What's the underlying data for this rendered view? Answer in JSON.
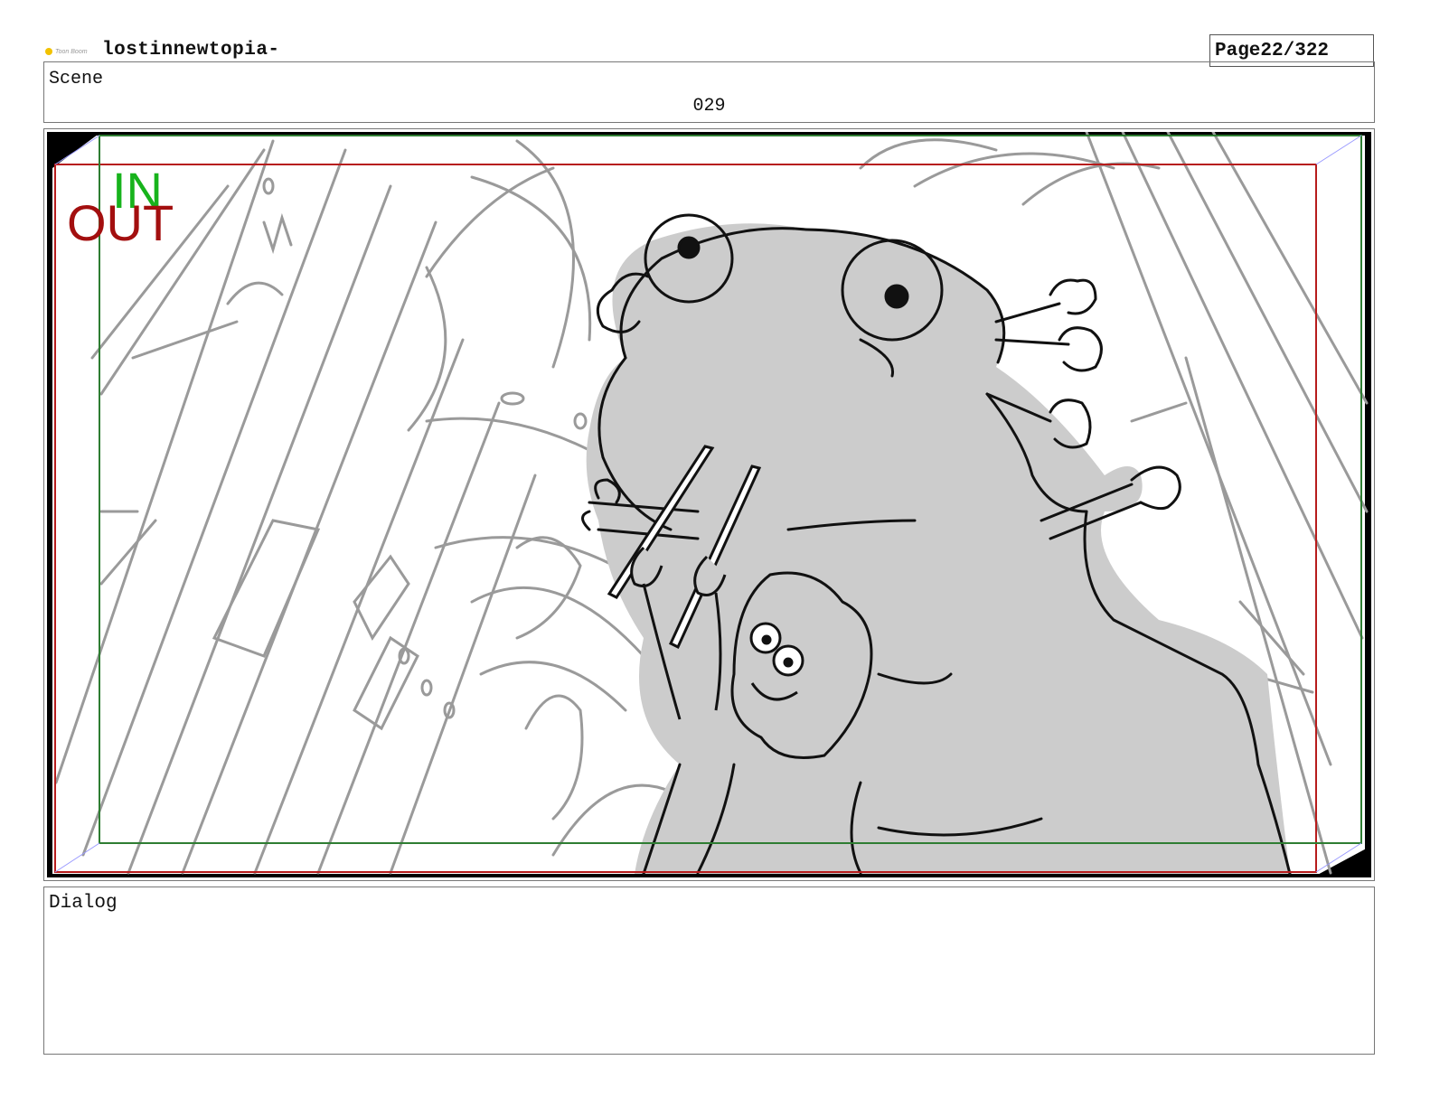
{
  "header": {
    "project_title": "lostinnewtopia-",
    "page_label": "Page",
    "page_number": "22/322"
  },
  "scene": {
    "label": "Scene",
    "number": "029"
  },
  "panel": {
    "in_marker": "IN",
    "out_marker": "OUT",
    "colors": {
      "in_frame": "#2e7d32",
      "out_frame": "#b71c1c",
      "in_text": "#17b31c",
      "out_text": "#a30f0f"
    }
  },
  "dialog": {
    "label": "Dialog"
  }
}
